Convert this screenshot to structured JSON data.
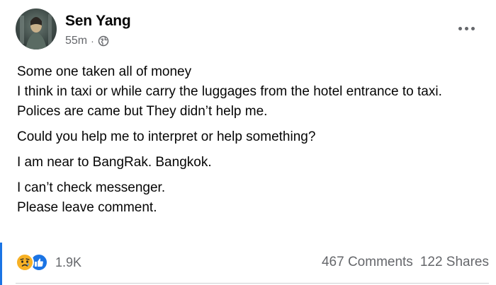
{
  "post": {
    "author": "Sen Yang",
    "time": "55m",
    "separator": "·",
    "privacy_icon": "globe-icon",
    "more_icon": "more-horizontal-icon",
    "paragraphs": [
      [
        "Some one taken all of money",
        "I think in taxi or while carry the luggages from the hotel entrance to taxi.",
        "Polices are came but They didn’t help me."
      ],
      [
        "Could you help me to interpret or help something?"
      ],
      [
        "I am near to BangRak. Bangkok."
      ],
      [
        "I can’t check messenger.",
        "Please leave comment."
      ]
    ],
    "reactions": {
      "icons": [
        "sad-reaction-icon",
        "like-reaction-icon"
      ],
      "count": "1.9K"
    },
    "comments": "467 Comments",
    "shares": "122 Shares"
  },
  "colors": {
    "accent": "#1b74e4",
    "sad": "#f7b125",
    "secondary_text": "#65676b"
  }
}
